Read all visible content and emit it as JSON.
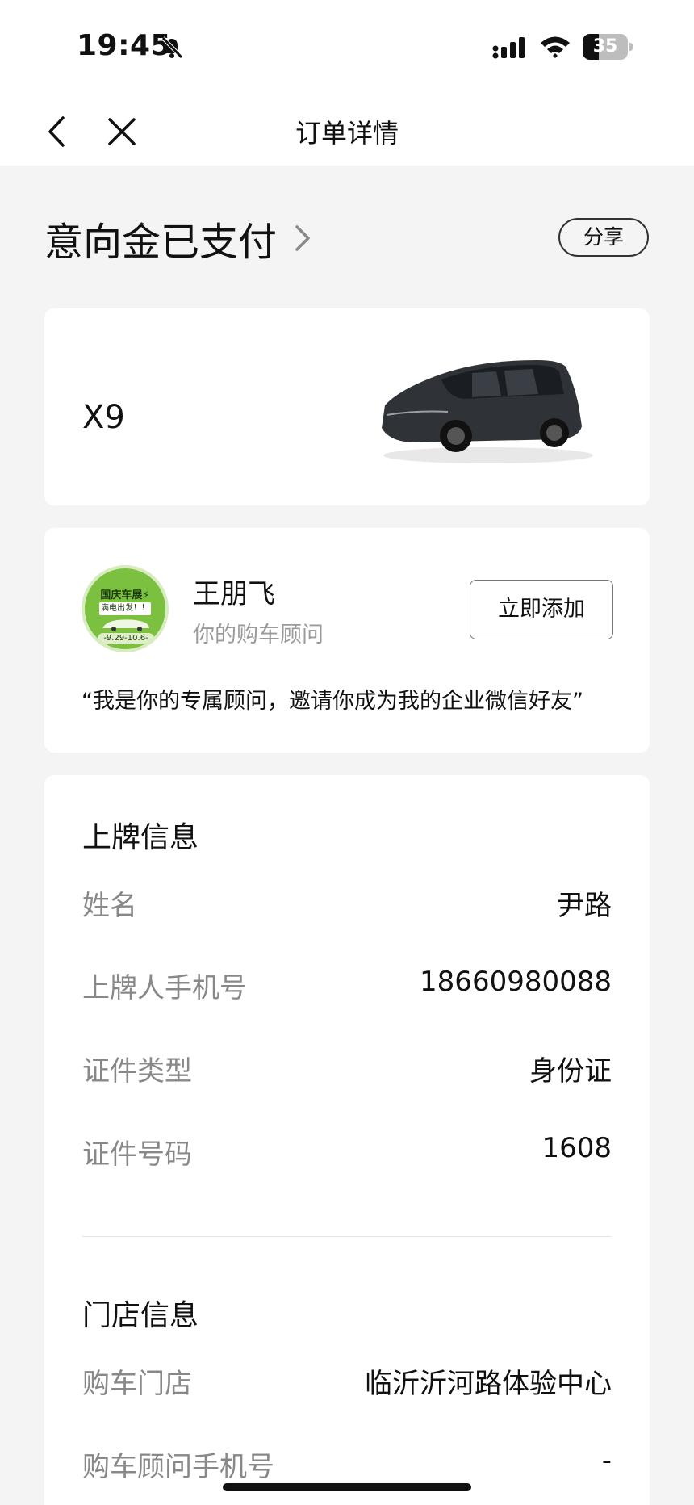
{
  "status_bar": {
    "time": "19:45",
    "battery": "35",
    "battery_level": 0.35
  },
  "nav": {
    "title": "订单详情"
  },
  "order": {
    "status": "意向金已支付",
    "share_label": "分享"
  },
  "car": {
    "model": "X9"
  },
  "advisor": {
    "name": "王朋飞",
    "role": "你的购车顾问",
    "add_label": "立即添加",
    "quote": "“我是你的专属顾问，邀请你成为我的企业微信好友”",
    "avatar_text": {
      "line1": "国庆车展⚡",
      "line2": "满电出发！！",
      "line3": "-9.29-10.6-"
    }
  },
  "plate_info": {
    "title": "上牌信息",
    "rows": [
      {
        "label": "姓名",
        "value": "尹路"
      },
      {
        "label": "上牌人手机号",
        "value": "18660980088"
      },
      {
        "label": "证件类型",
        "value": "身份证"
      },
      {
        "label": "证件号码",
        "value": "1608"
      }
    ]
  },
  "store_info": {
    "title": "门店信息",
    "rows": [
      {
        "label": "购车门店",
        "value": "临沂沂河路体验中心"
      },
      {
        "label": "购车顾问手机号",
        "value": "-"
      }
    ]
  },
  "colors": {
    "background": "#f4f4f4",
    "card": "#ffffff",
    "avatar_green": "#7cc040",
    "muted_text": "#888888"
  }
}
